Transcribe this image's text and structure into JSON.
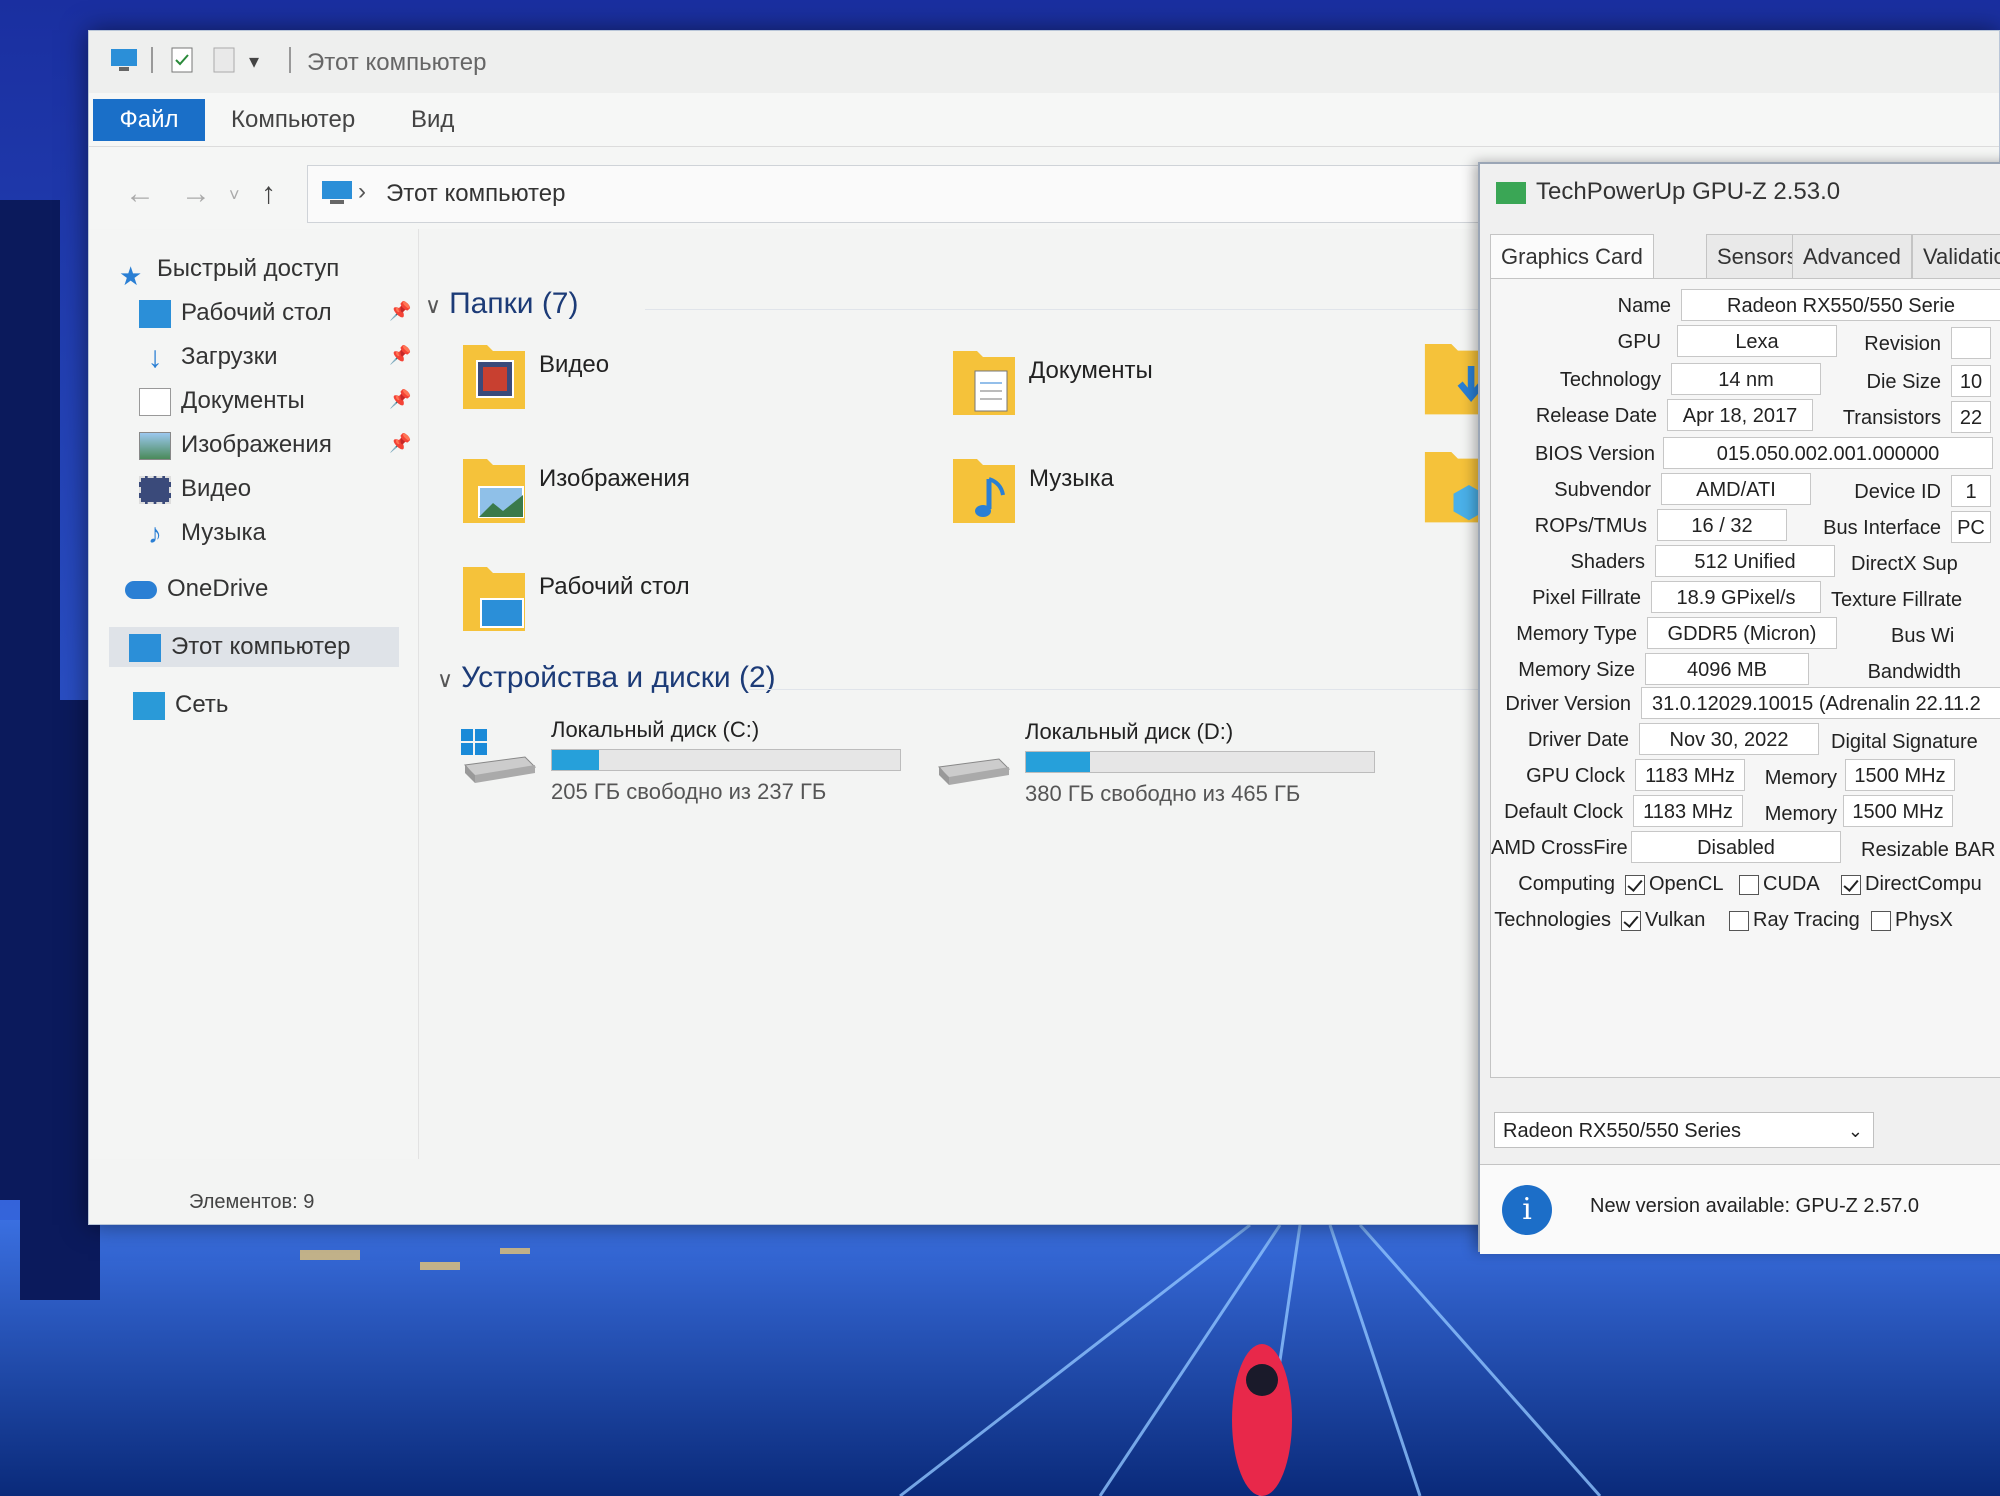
{
  "explorer": {
    "title": "Этот компьютер",
    "ribbon_tabs": [
      "Файл",
      "Компьютер",
      "Вид"
    ],
    "address": "Этот компьютер",
    "nav": {
      "quick_access": "Быстрый доступ",
      "items": [
        "Рабочий стол",
        "Загрузки",
        "Документы",
        "Изображения",
        "Видео",
        "Музыка"
      ],
      "onedrive": "OneDrive",
      "this_pc": "Этот компьютер",
      "network": "Сеть"
    },
    "folders_group": "Папки (7)",
    "folders": [
      "Видео",
      "Документы",
      "Изображения",
      "Музыка",
      "Рабочий стол"
    ],
    "devices_group": "Устройства и диски (2)",
    "drives": [
      {
        "name": "Локальный диск (C:)",
        "free": "205 ГБ свободно из 237 ГБ",
        "used_fraction": 0.135
      },
      {
        "name": "Локальный диск (D:)",
        "free": "380 ГБ свободно из 465 ГБ",
        "used_fraction": 0.183
      }
    ],
    "status": "Элементов: 9"
  },
  "gpuz": {
    "title": "TechPowerUp GPU-Z 2.53.0",
    "tabs": [
      "Graphics Card",
      "Sensors",
      "Advanced",
      "Validatio"
    ],
    "labels": {
      "name": "Name",
      "gpu": "GPU",
      "revision": "Revision",
      "technology": "Technology",
      "die_size": "Die Size",
      "release_date": "Release Date",
      "transistors": "Transistors",
      "bios": "BIOS Version",
      "subvendor": "Subvendor",
      "device_id": "Device ID",
      "rops": "ROPs/TMUs",
      "bus_interface": "Bus Interface",
      "shaders": "Shaders",
      "directx": "DirectX Sup",
      "pixel_fillrate": "Pixel Fillrate",
      "texture_fillrate": "Texture Fillrate",
      "memory_type": "Memory Type",
      "bus_width": "Bus Wi",
      "memory_size": "Memory Size",
      "bandwidth": "Bandwidth",
      "driver_version": "Driver Version",
      "driver_date": "Driver Date",
      "digital_signature": "Digital Signature",
      "gpu_clock": "GPU Clock",
      "memory": "Memory",
      "default_clock": "Default Clock",
      "crossfire": "AMD CrossFire",
      "resizable_bar": "Resizable BAR",
      "computing": "Computing",
      "technologies": "Technologies"
    },
    "values": {
      "name": "Radeon RX550/550 Serie",
      "gpu": "Lexa",
      "technology": "14 nm",
      "release_date": "Apr 18, 2017",
      "bios": "015.050.002.001.000000",
      "subvendor": "AMD/ATI",
      "rops": "16 / 32",
      "shaders": "512 Unified",
      "pixel_fillrate": "18.9 GPixel/s",
      "memory_type": "GDDR5 (Micron)",
      "memory_size": "4096 MB",
      "driver_version": "31.0.12029.10015 (Adrenalin 22.11.2",
      "driver_date": "Nov 30, 2022",
      "gpu_clock": "1183 MHz",
      "gpu_mem": "1500 MHz",
      "default_clock": "1183 MHz",
      "default_mem": "1500 MHz",
      "crossfire": "Disabled",
      "die_size_partial": "10",
      "transistors_partial": "22",
      "device_id_partial": "1",
      "bus_partial": "PC"
    },
    "computing": [
      {
        "label": "OpenCL",
        "checked": true
      },
      {
        "label": "CUDA",
        "checked": false
      },
      {
        "label": "DirectCompu",
        "checked": true
      }
    ],
    "technologies": [
      {
        "label": "Vulkan",
        "checked": true
      },
      {
        "label": "Ray Tracing",
        "checked": false
      },
      {
        "label": "PhysX",
        "checked": false
      }
    ],
    "selected_card": "Radeon RX550/550 Series",
    "update_notice": "New version available: GPU-Z 2.57.0"
  },
  "colors": {
    "accent": "#1a6fc8",
    "drive_fill": "#26a0da",
    "folder": "#f5c23a"
  }
}
